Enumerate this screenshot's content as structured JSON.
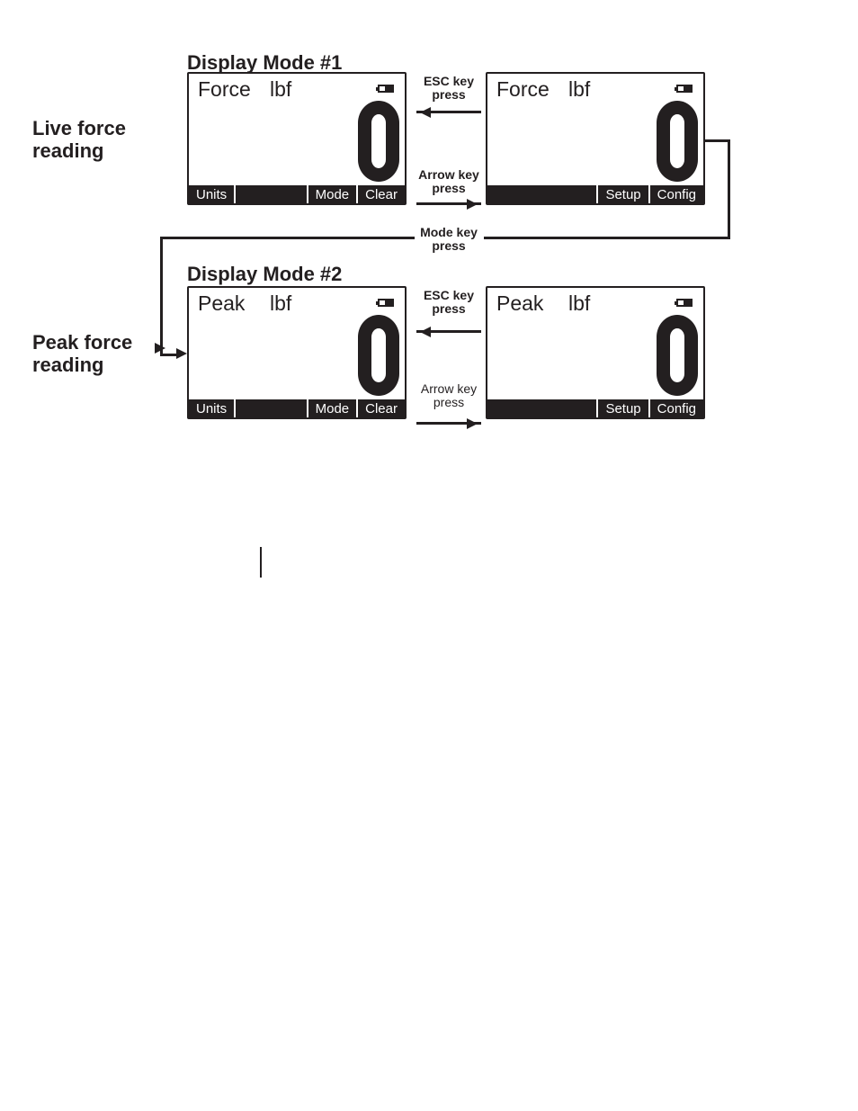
{
  "headings": {
    "mode1": "Display Mode #1",
    "mode2": "Display Mode #2"
  },
  "side_labels": {
    "live": "Live force reading",
    "peak": "Peak force reading"
  },
  "transitions": {
    "esc": "ESC key press",
    "arrow": "Arrow key press",
    "mode": "Mode key press"
  },
  "panels": {
    "live_main": {
      "title": "Force",
      "unit": "lbf",
      "value": "0",
      "soft": [
        "Units",
        "Mode",
        "Clear"
      ]
    },
    "live_menu": {
      "title": "Force",
      "unit": "lbf",
      "value": "0",
      "soft": [
        "Setup",
        "Config"
      ]
    },
    "peak_main": {
      "title": "Peak",
      "unit": "lbf",
      "value": "0",
      "soft": [
        "Units",
        "Mode",
        "Clear"
      ]
    },
    "peak_menu": {
      "title": "Peak",
      "unit": "lbf",
      "value": "0",
      "soft": [
        "Setup",
        "Config"
      ]
    }
  }
}
